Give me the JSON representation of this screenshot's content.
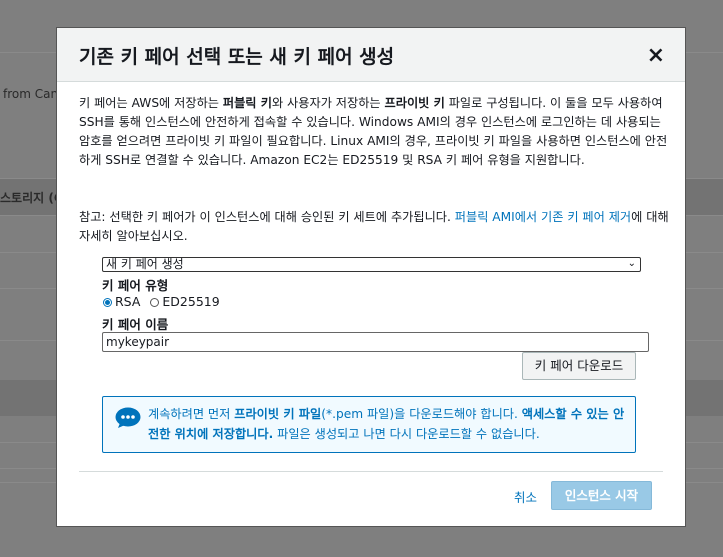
{
  "background": {
    "fragment_1": "from Cand",
    "fragment_2": "스토리지 (C"
  },
  "modal": {
    "title": "기존 키 페어 선택 또는 새 키 페어 생성",
    "close_label": "×",
    "intro": {
      "p1": "키 페어는 AWS에 저장하는 ",
      "p1_bold1": "퍼블릭 키",
      "p2": "와 사용자가 저장하는 ",
      "p2_bold2": "프라이빗 키",
      "p3": " 파일로 구성됩니다. 이 둘을 모두 사용하여 SSH를 통해 인스턴스에 안전하게 접속할 수 있습니다. Windows AMI의 경우 인스턴스에 로그인하는 데 사용되는 암호를 얻으려면 프라이빗 키 파일이 필요합니다. Linux AMI의 경우, 프라이빗 키 파일을 사용하면 인스턴스에 안전하게 SSH로 연결할 수 있습니다. Amazon EC2는 ED25519 및 RSA 키 페어 유형을 지원합니다."
    },
    "note": {
      "text": "참고: 선택한 키 페어가 이 인스턴스에 대해 승인된 키 세트에 추가됩니다. ",
      "link": "퍼블릭 AMI에서 기존 키 페어 제거",
      "tail": "에 대해 자세히 알아보십시오."
    },
    "select_value": "새 키 페어 생성",
    "key_type_label": "키 페어 유형",
    "key_type_options": [
      "RSA",
      "ED25519"
    ],
    "key_type_selected": "RSA",
    "key_name_label": "키 페어 이름",
    "key_name_value": "mykeypair",
    "download_button": "키 페어 다운로드",
    "info": {
      "t1": "계속하려면 먼저 ",
      "b1": "프라이빗 키 파일",
      "t2": "(*.pem 파일)을 다운로드해야 합니다. ",
      "b2": "액세스할 수 있는 안전한 위치에 저장합니다.",
      "t3": " 파일은 생성되고 나면 다시 다운로드할 수 없습니다."
    },
    "cancel_label": "취소",
    "launch_label": "인스턴스 시작"
  }
}
